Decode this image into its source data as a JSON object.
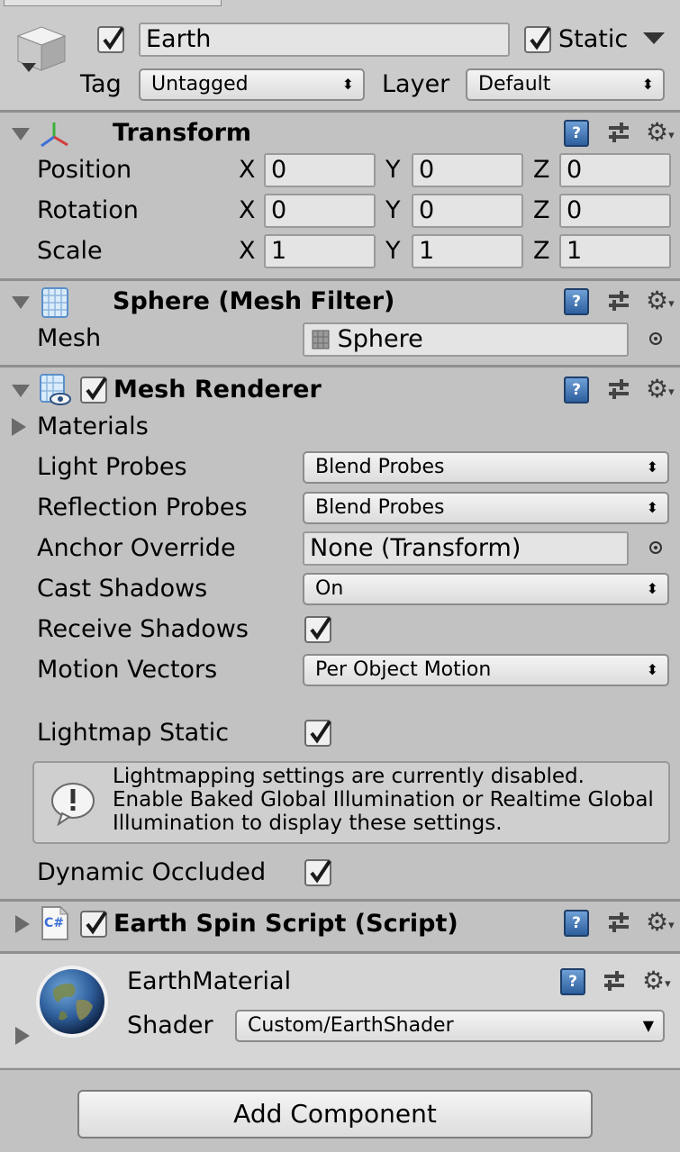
{
  "object": {
    "name": "Earth",
    "static_label": "Static",
    "tag_label": "Tag",
    "tag_value": "Untagged",
    "layer_label": "Layer",
    "layer_value": "Default"
  },
  "transform": {
    "title": "Transform",
    "rows": [
      {
        "label": "Position",
        "x": "0",
        "y": "0",
        "z": "0"
      },
      {
        "label": "Rotation",
        "x": "0",
        "y": "0",
        "z": "0"
      },
      {
        "label": "Scale",
        "x": "1",
        "y": "1",
        "z": "1"
      }
    ],
    "axis_x": "X",
    "axis_y": "Y",
    "axis_z": "Z"
  },
  "mesh_filter": {
    "title": "Sphere (Mesh Filter)",
    "mesh_label": "Mesh",
    "mesh_value": "Sphere"
  },
  "mesh_renderer": {
    "title": "Mesh Renderer",
    "materials_label": "Materials",
    "light_probes_label": "Light Probes",
    "light_probes_value": "Blend Probes",
    "reflection_probes_label": "Reflection Probes",
    "reflection_probes_value": "Blend Probes",
    "anchor_override_label": "Anchor Override",
    "anchor_override_value": "None (Transform)",
    "cast_shadows_label": "Cast Shadows",
    "cast_shadows_value": "On",
    "receive_shadows_label": "Receive Shadows",
    "motion_vectors_label": "Motion Vectors",
    "motion_vectors_value": "Per Object Motion",
    "lightmap_static_label": "Lightmap Static",
    "info_line1": "Lightmapping settings are currently disabled.",
    "info_line2": "Enable Baked Global Illumination or Realtime Global",
    "info_line3": "Illumination to display these settings.",
    "dynamic_occluded_label": "Dynamic Occluded"
  },
  "script": {
    "title": "Earth Spin Script (Script)",
    "icon_text": "C#"
  },
  "material": {
    "name": "EarthMaterial",
    "shader_label": "Shader",
    "shader_value": "Custom/EarthShader"
  },
  "add_component_label": "Add Component"
}
